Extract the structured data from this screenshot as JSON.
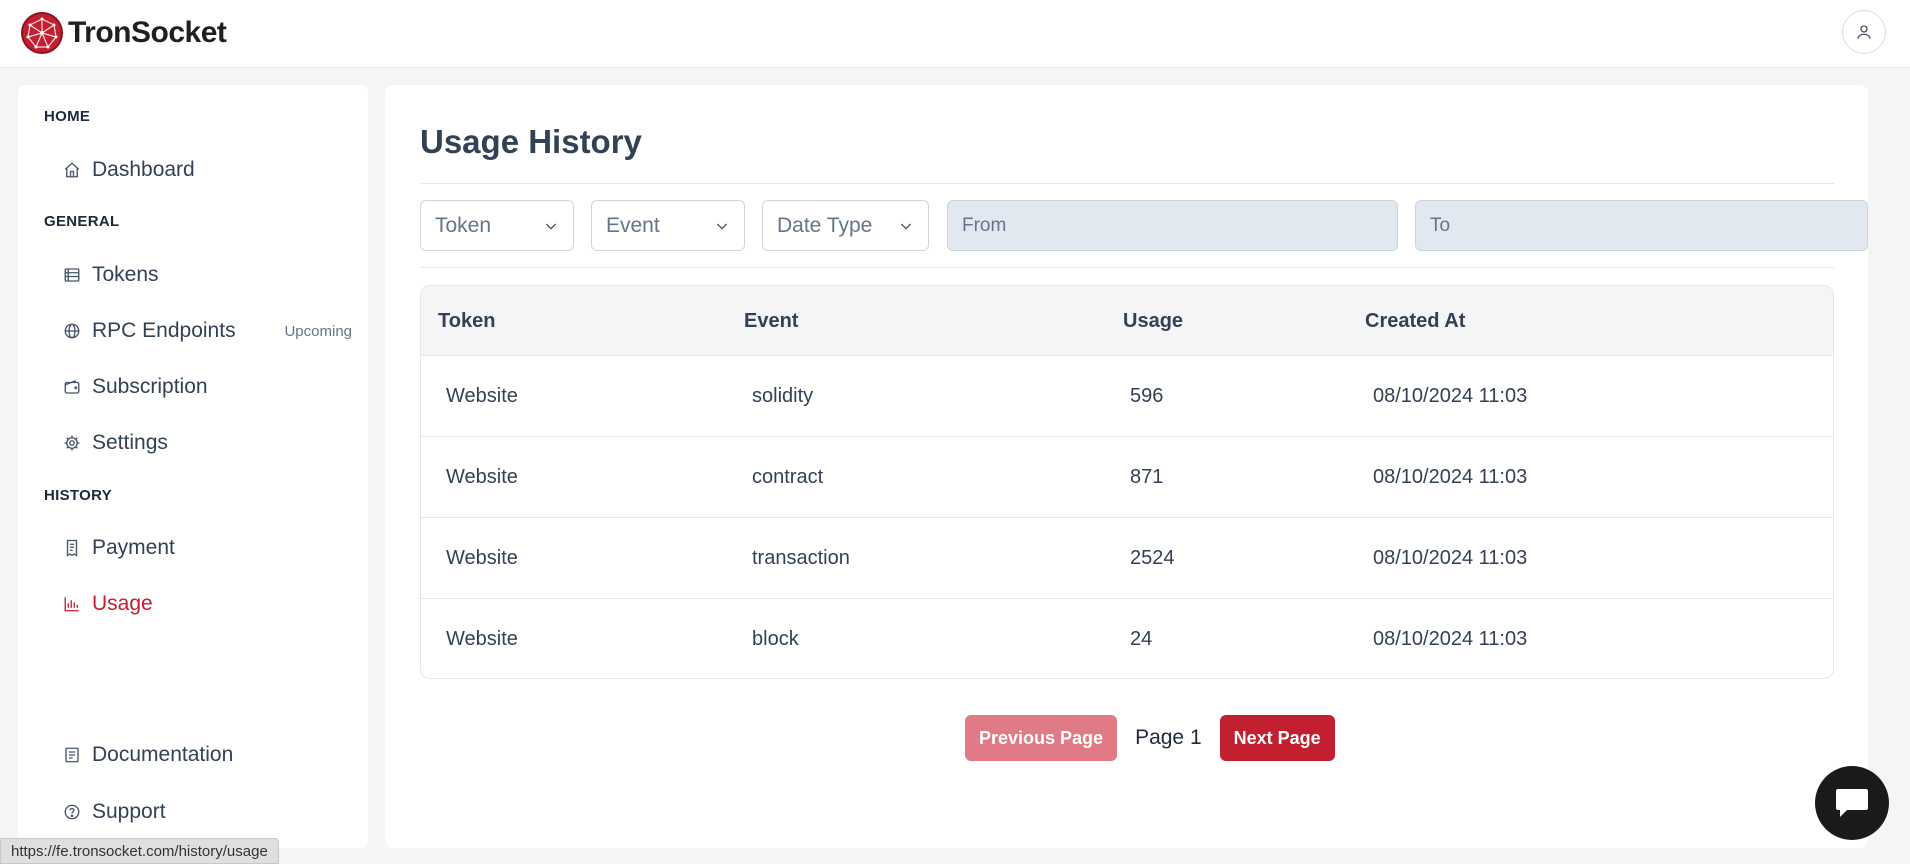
{
  "brand": {
    "name": "TronSocket",
    "accent": "#c21f30"
  },
  "sidebar": {
    "sections": {
      "home": "HOME",
      "general": "GENERAL",
      "history": "HISTORY"
    },
    "items": {
      "dashboard": {
        "label": "Dashboard",
        "icon": "home-icon"
      },
      "tokens": {
        "label": "Tokens",
        "icon": "stack-icon"
      },
      "rpc": {
        "label": "RPC Endpoints",
        "icon": "globe-icon",
        "badge": "Upcoming"
      },
      "subscription": {
        "label": "Subscription",
        "icon": "wallet-icon"
      },
      "settings": {
        "label": "Settings",
        "icon": "gear-icon"
      },
      "payment": {
        "label": "Payment",
        "icon": "receipt-icon"
      },
      "usage": {
        "label": "Usage",
        "icon": "bar-chart-icon",
        "active": true
      },
      "documentation": {
        "label": "Documentation",
        "icon": "document-icon"
      },
      "support": {
        "label": "Support",
        "icon": "help-circle-icon"
      }
    }
  },
  "main": {
    "title": "Usage History",
    "filters": {
      "token": "Token",
      "event": "Event",
      "date_type": "Date Type",
      "from_placeholder": "From",
      "to_placeholder": "To"
    },
    "table": {
      "headers": {
        "token": "Token",
        "event": "Event",
        "usage": "Usage",
        "created_at": "Created At"
      },
      "rows": [
        {
          "token": "Website",
          "event": "solidity",
          "usage": "596",
          "created_at": "08/10/2024 11:03"
        },
        {
          "token": "Website",
          "event": "contract",
          "usage": "871",
          "created_at": "08/10/2024 11:03"
        },
        {
          "token": "Website",
          "event": "transaction",
          "usage": "2524",
          "created_at": "08/10/2024 11:03"
        },
        {
          "token": "Website",
          "event": "block",
          "usage": "24",
          "created_at": "08/10/2024 11:03"
        }
      ]
    },
    "pagination": {
      "prev": "Previous Page",
      "page": "Page 1",
      "next": "Next Page"
    }
  },
  "statusbar": {
    "url": "https://fe.tronsocket.com/history/usage"
  }
}
